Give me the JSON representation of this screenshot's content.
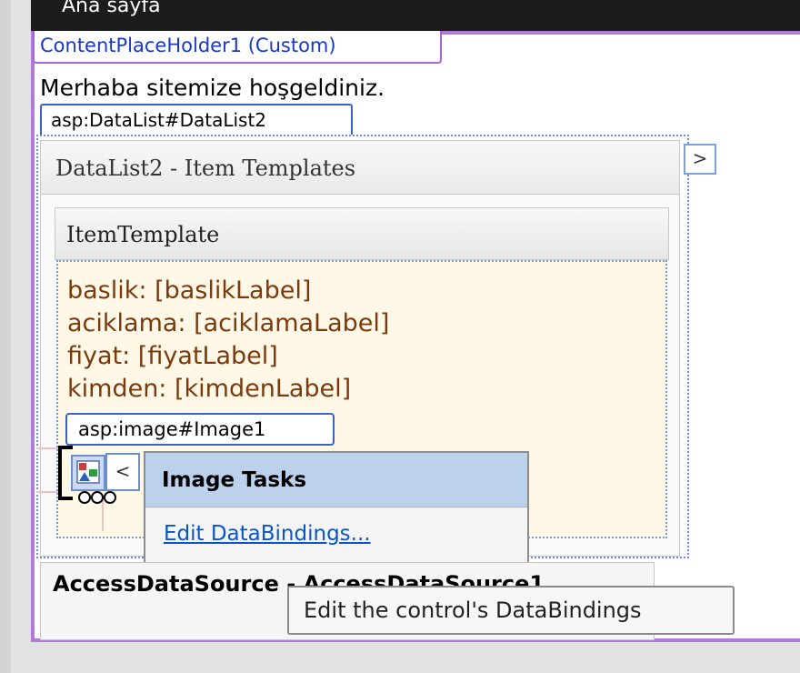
{
  "top_bar": {
    "text": "Ana sayfa"
  },
  "content_placeholder": {
    "tab_label": "ContentPlaceHolder1 (Custom)"
  },
  "page": {
    "welcome_text": "Merhaba sitemize hoşgeldiniz."
  },
  "datalist": {
    "tag_label": "asp:DataList#DataList2",
    "templates_title": "DataList2 - Item Templates",
    "collapse_glyph": ">",
    "item_template": {
      "header": "ItemTemplate",
      "fields": [
        "baslik: [baslikLabel]",
        "aciklama: [aciklamaLabel]",
        "fiyat: [fiyatLabel]",
        "kimden: [kimdenLabel]"
      ]
    }
  },
  "image_control": {
    "tag_label": "asp:image#Image1",
    "smart_tag_glyph": "<"
  },
  "image_tasks": {
    "title": "Image Tasks",
    "edit_databindings_link": "Edit DataBindings..."
  },
  "access_data_source": {
    "label": "AccessDataSource - AccessDataSource1"
  },
  "tooltip": {
    "text": "Edit the control's DataBindings"
  },
  "colors": {
    "placeholder_border": "#b07ad8",
    "tasks_header": "#bcd1ec",
    "item_template_bg": "#fff8e7",
    "field_text": "#7a3a0d",
    "link": "#0b56c6"
  }
}
